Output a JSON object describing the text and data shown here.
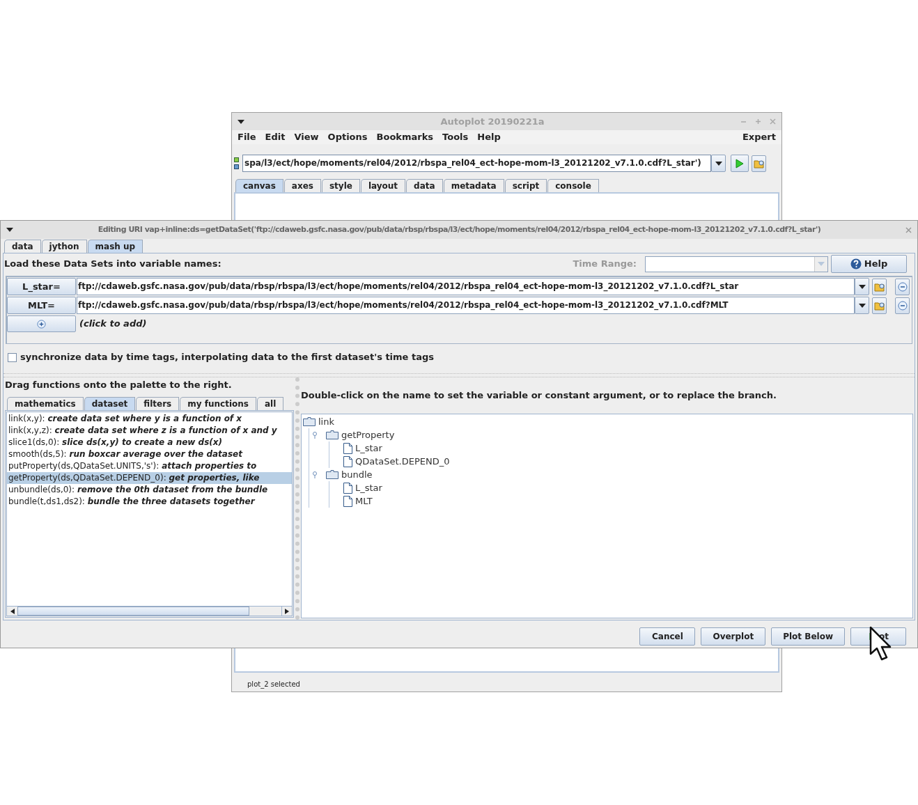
{
  "main_window": {
    "title": "Autoplot 20190221a",
    "menu": [
      "File",
      "Edit",
      "View",
      "Options",
      "Bookmarks",
      "Tools",
      "Help"
    ],
    "menu_right": "Expert",
    "uri": "spa/l3/ect/hope/moments/rel04/2012/rbspa_rel04_ect-hope-mom-l3_20121202_v7.1.0.cdf?L_star')",
    "tabs": [
      {
        "label": "canvas",
        "selected": true
      },
      {
        "label": "axes",
        "selected": false
      },
      {
        "label": "style",
        "selected": false
      },
      {
        "label": "layout",
        "selected": false
      },
      {
        "label": "data",
        "selected": false
      },
      {
        "label": "metadata",
        "selected": false
      },
      {
        "label": "script",
        "selected": false
      },
      {
        "label": "console",
        "selected": false
      }
    ],
    "status_bar": "plot_2 selected"
  },
  "dialog": {
    "title": "Editing URI vap+inline:ds=getDataSet('ftp://cdaweb.gsfc.nasa.gov/pub/data/rbsp/rbspa/l3/ect/hope/moments/rel04/2012/rbspa_rel04_ect-hope-mom-l3_20121202_v7.1.0.cdf?L_star')",
    "tabs": [
      {
        "label": "data",
        "selected": false
      },
      {
        "label": "jython",
        "selected": false
      },
      {
        "label": "mash up",
        "selected": true
      }
    ],
    "heading": "Load these Data Sets into variable names:",
    "time_range_label": "Time Range:",
    "help_button": "Help",
    "datasets": [
      {
        "name": "L_star=",
        "uri": "ftp://cdaweb.gsfc.nasa.gov/pub/data/rbsp/rbspa/l3/ect/hope/moments/rel04/2012/rbspa_rel04_ect-hope-mom-l3_20121202_v7.1.0.cdf?L_star"
      },
      {
        "name": "MLT=",
        "uri": "ftp://cdaweb.gsfc.nasa.gov/pub/data/rbsp/rbspa/l3/ect/hope/moments/rel04/2012/rbspa_rel04_ect-hope-mom-l3_20121202_v7.1.0.cdf?MLT"
      }
    ],
    "add_hint": "(click to add)",
    "sync": {
      "label": "synchronize data by time tags, interpolating data to the first dataset's time tags",
      "checked": false
    },
    "palette": {
      "heading": "Drag functions onto the palette to the right.",
      "tabs": [
        {
          "label": "mathematics",
          "selected": false
        },
        {
          "label": "dataset",
          "selected": true
        },
        {
          "label": "filters",
          "selected": false
        },
        {
          "label": "my functions",
          "selected": false
        },
        {
          "label": "all",
          "selected": false
        }
      ],
      "functions": [
        {
          "text": "link(x,y): *create data set where y is a function of x*",
          "selected": false
        },
        {
          "text": "link(x,y,z): *create data set where z is a function of x and y*",
          "selected": false
        },
        {
          "text": "slice1(ds,0): *slice ds(x,y) to create a new ds(x)*",
          "selected": false
        },
        {
          "text": "smooth(ds,5): *run boxcar average over the dataset*",
          "selected": false
        },
        {
          "text": "putProperty(ds,QDataSet.UNITS,'s'): *attach properties to*",
          "selected": false
        },
        {
          "text": "getProperty(ds,QDataSet.DEPEND_0): *get properties, like*",
          "selected": true
        },
        {
          "text": "unbundle(ds,0): *remove the 0th dataset from the bundle*",
          "selected": false
        },
        {
          "text": "bundle(t,ds1,ds2): *bundle the three datasets together*",
          "selected": false
        }
      ]
    },
    "tree_panel": {
      "instructions": "Double-click on the name to set the variable or constant argument, or to replace the branch.",
      "tree": {
        "label": "link",
        "children": [
          {
            "label": "getProperty",
            "children": [
              {
                "label": "L_star"
              },
              {
                "label": "QDataSet.DEPEND_0"
              }
            ]
          },
          {
            "label": "bundle",
            "children": [
              {
                "label": "L_star"
              },
              {
                "label": "MLT"
              }
            ]
          }
        ]
      }
    },
    "buttons": [
      "Cancel",
      "Overplot",
      "Plot Below",
      "ot"
    ]
  }
}
